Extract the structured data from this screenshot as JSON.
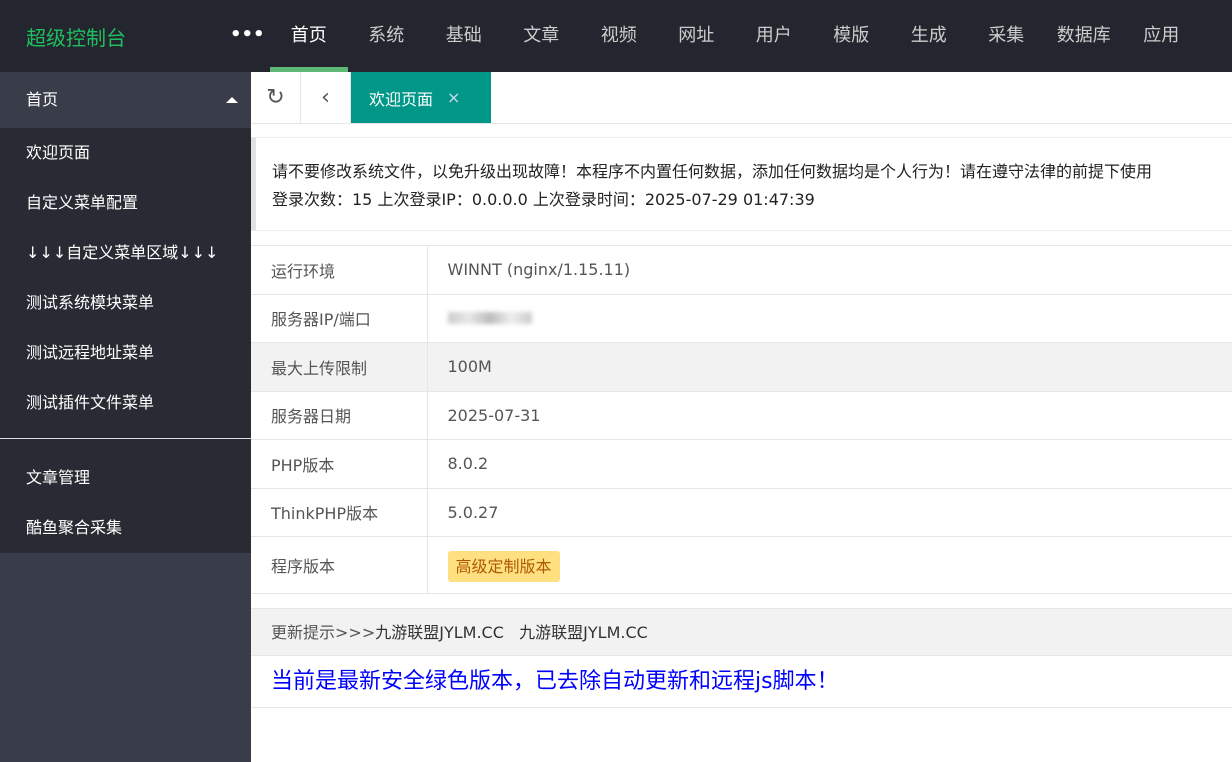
{
  "header": {
    "logo": "超级控制台",
    "more": "•••",
    "nav": [
      "首页",
      "系统",
      "基础",
      "文章",
      "视频",
      "网址",
      "用户",
      "模版",
      "生成",
      "采集",
      "数据库",
      "应用"
    ]
  },
  "sidebar": {
    "head": "首页",
    "items": [
      "欢迎页面",
      "自定义菜单配置",
      "↓↓↓自定义菜单区域↓↓↓",
      "测试系统模块菜单",
      "测试远程地址菜单",
      "测试插件文件菜单"
    ],
    "items2": [
      "文章管理",
      "酷鱼聚合采集"
    ]
  },
  "tabs": {
    "active": "欢迎页面",
    "close": "×"
  },
  "notice": {
    "line1": "请不要修改系统文件，以免升级出现故障！本程序不内置任何数据，添加任何数据均是个人行为！请在遵守法律的前提下使用",
    "line2": "登录次数：15 上次登录IP：0.0.0.0 上次登录时间：2025-07-29 01:47:39"
  },
  "info": [
    {
      "label": "运行环境",
      "value": "WINNT (nginx/1.15.11)"
    },
    {
      "label": "服务器IP/端口",
      "value": ""
    },
    {
      "label": "最大上传限制",
      "value": "100M"
    },
    {
      "label": "服务器日期",
      "value": "2025-07-31"
    },
    {
      "label": "PHP版本",
      "value": "8.0.2"
    },
    {
      "label": "ThinkPHP版本",
      "value": "5.0.27"
    },
    {
      "label": "程序版本",
      "value": "高级定制版本"
    }
  ],
  "update": {
    "prefix": "更新提示>>>",
    "link1": "九游联盟JYLM.CC",
    "link2": "九游联盟JYLM.CC",
    "message": "当前是最新安全绿色版本，已去除自动更新和远程js脚本！"
  }
}
